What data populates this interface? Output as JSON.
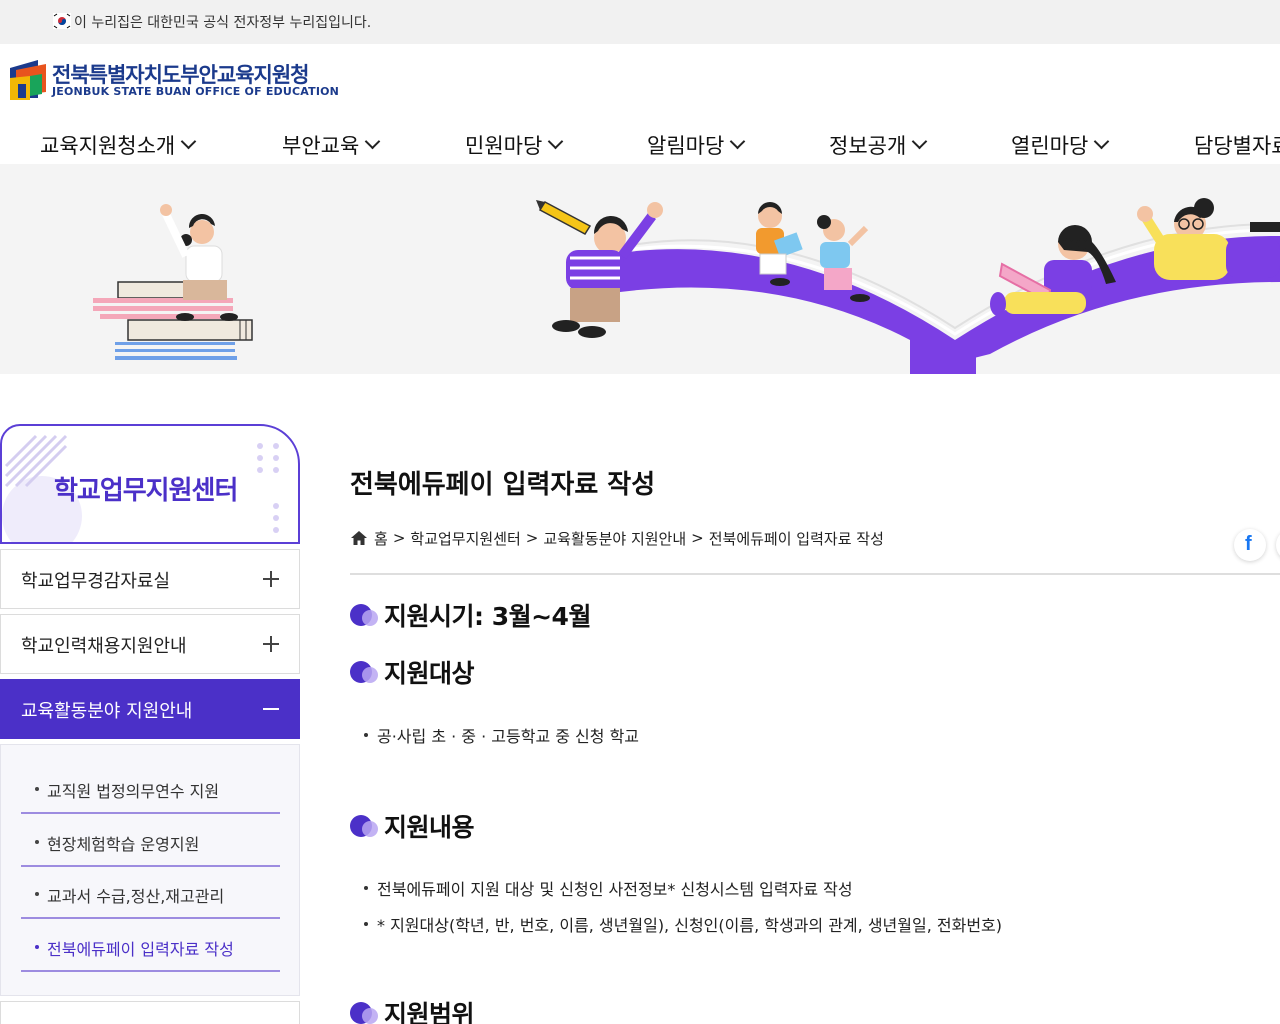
{
  "gov_bar": {
    "text": "이 누리집은 대한민국 공식 전자정부 누리집입니다."
  },
  "logo": {
    "title_ko": "전북특별자치도부안교육지원청",
    "title_en": "JEONBUK STATE BUAN OFFICE OF EDUCATION"
  },
  "gnb": {
    "items": [
      {
        "label": "교육지원청소개"
      },
      {
        "label": "부안교육"
      },
      {
        "label": "민원마당"
      },
      {
        "label": "알림마당"
      },
      {
        "label": "정보공개"
      },
      {
        "label": "열린마당"
      },
      {
        "label": "담당별자료"
      }
    ]
  },
  "sidebar": {
    "title": "학교업무지원센터",
    "menu": [
      {
        "label": "학교업무경감자료실"
      },
      {
        "label": "학교인력채용지원안내"
      },
      {
        "label": "교육활동분야 지원안내"
      }
    ],
    "submenu": [
      {
        "label": "교직원 법정의무연수 지원"
      },
      {
        "label": "현장체험학습 운영지원"
      },
      {
        "label": "교과서 수급,정산,재고관리"
      },
      {
        "label": "전북에듀페이 입력자료 작성"
      }
    ]
  },
  "main": {
    "title": "전북에듀페이 입력자료 작성",
    "breadcrumb": [
      "홈",
      "학교업무지원센터",
      "교육활동분야 지원안내",
      "전북에듀페이 입력자료 작성"
    ],
    "share_icon_letter": "f",
    "sections": [
      {
        "heading": "지원시기: 3월~4월",
        "lines": []
      },
      {
        "heading": "지원대상",
        "lines": [
          "공·사립 초 · 중 · 고등학교 중 신청 학교"
        ]
      },
      {
        "heading": "지원내용",
        "lines": [
          "전북에듀페이 지원 대상 및 신청인 사전정보* 신청시스템 입력자료 작성",
          "* 지원대상(학년, 반, 번호, 이름, 생년월일), 신청인(이름, 학생과의 관계, 생년월일, 전화번호)"
        ]
      },
      {
        "heading": "지원범위",
        "lines": []
      }
    ]
  },
  "colors": {
    "accent": "#4b30c8",
    "brand": "#1b3a8c",
    "gov_bar": "#f1f1f1"
  }
}
